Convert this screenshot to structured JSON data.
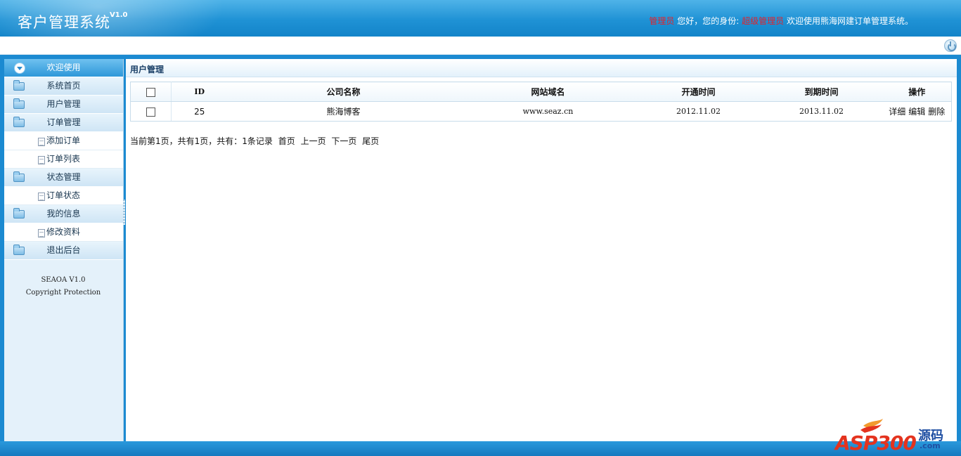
{
  "header": {
    "title": "客户管理系统",
    "version": "V1.0",
    "user_role_label": "管理员",
    "greeting": "您好，您的身份:",
    "identity": "超级管理员",
    "welcome": "欢迎使用熊海网建订单管理系统。"
  },
  "toolbar": {
    "power_icon": "power-icon"
  },
  "sidebar": {
    "items": [
      {
        "label": "欢迎使用",
        "type": "top",
        "icon": "circle-down-icon"
      },
      {
        "label": "系统首页",
        "type": "group",
        "icon": "folder-icon"
      },
      {
        "label": "用户管理",
        "type": "group",
        "icon": "folder-icon"
      },
      {
        "label": "订单管理",
        "type": "group",
        "icon": "folder-icon"
      },
      {
        "label": "添加订单",
        "type": "sub",
        "icon": "document-icon"
      },
      {
        "label": "订单列表",
        "type": "sub",
        "icon": "document-icon"
      },
      {
        "label": "状态管理",
        "type": "group",
        "icon": "folder-icon"
      },
      {
        "label": "订单状态",
        "type": "sub",
        "icon": "document-icon"
      },
      {
        "label": "我的信息",
        "type": "group",
        "icon": "folder-icon"
      },
      {
        "label": "修改资料",
        "type": "sub",
        "icon": "document-icon"
      },
      {
        "label": "退出后台",
        "type": "group",
        "icon": "folder-icon"
      }
    ],
    "footer_line1": "SEAOA V1.0",
    "footer_line2": "Copyright Protection"
  },
  "main": {
    "title": "用户管理",
    "columns": [
      "ID",
      "公司名称",
      "网站域名",
      "开通时间",
      "到期时间",
      "操作"
    ],
    "rows": [
      {
        "id": "25",
        "company": "熊海博客",
        "domain": "www.seaz.cn",
        "start": "2012.11.02",
        "end": "2013.11.02",
        "actions": [
          "详细",
          "编辑",
          "删除"
        ]
      }
    ],
    "pager": {
      "summary": "当前第1页，共有1页，共有：1条记录",
      "first": "首页",
      "prev": "上一页",
      "next": "下一页",
      "last": "尾页"
    }
  },
  "watermark": {
    "text": "ASP300",
    "sub": "源码",
    "com": ".com"
  },
  "colors": {
    "header_blue": "#1f92d5",
    "frame_blue": "#1b8ad1",
    "highlight_red": "#e0242d"
  }
}
